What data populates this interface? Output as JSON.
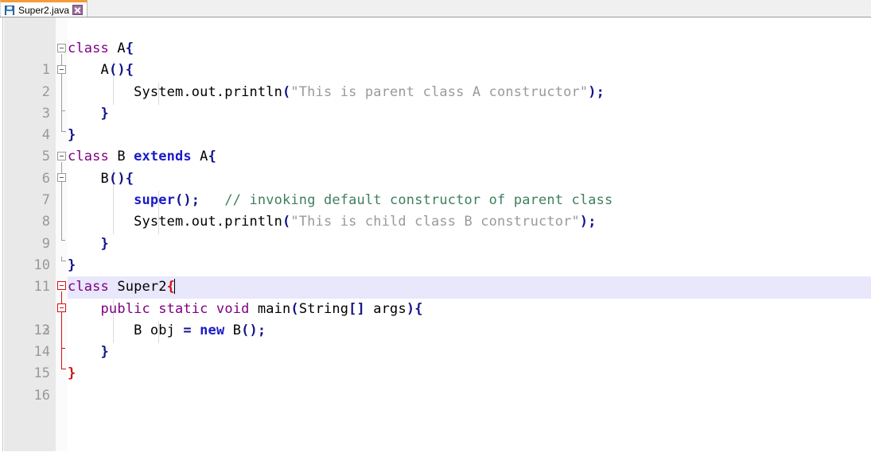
{
  "window": {
    "title": "Super2.java"
  },
  "tab": {
    "label": "Super2.java",
    "save_icon": "save-floppy-icon",
    "close_icon": "close-icon",
    "active": true,
    "active_indicator_color": "#f29d38"
  },
  "editor": {
    "language": "java",
    "current_line": 12,
    "caret_line": 12,
    "caret_column": 15,
    "colors": {
      "background": "#ffffff",
      "gutter": "#e9e9e9",
      "line_number": "#999999",
      "current_line_highlight": "#e9e7fb",
      "keyword": "#7f0080",
      "keyword_bold": "#1a1acc",
      "punctuation": "#14148c",
      "string": "#9a9a9a",
      "comment": "#3f7f5f",
      "matched_brace": "#d01414",
      "identifier": "#000000"
    },
    "line_numbers": [
      1,
      2,
      3,
      4,
      5,
      6,
      7,
      8,
      9,
      10,
      11,
      12,
      13,
      14,
      15,
      16
    ],
    "lines": [
      {
        "n": 1,
        "text": "class A{"
      },
      {
        "n": 2,
        "text": "    A(){"
      },
      {
        "n": 3,
        "text": "        System.out.println(\"This is parent class A constructor\");"
      },
      {
        "n": 4,
        "text": "    }"
      },
      {
        "n": 5,
        "text": "}"
      },
      {
        "n": 6,
        "text": "class B extends A{"
      },
      {
        "n": 7,
        "text": "    B(){"
      },
      {
        "n": 8,
        "text": "        super();   // invoking default constructor of parent class"
      },
      {
        "n": 9,
        "text": "        System.out.println(\"This is child class B constructor\");"
      },
      {
        "n": 10,
        "text": "    }"
      },
      {
        "n": 11,
        "text": "}"
      },
      {
        "n": 12,
        "text": "class Super2{"
      },
      {
        "n": 13,
        "text": "    public static void main(String[] args){"
      },
      {
        "n": 14,
        "text": "        B obj = new B();"
      },
      {
        "n": 15,
        "text": "    }"
      },
      {
        "n": 16,
        "text": "}"
      }
    ],
    "fold_markers": [
      {
        "line": 1,
        "state": "expanded",
        "color": "gray"
      },
      {
        "line": 2,
        "state": "expanded",
        "color": "gray"
      },
      {
        "line": 6,
        "state": "expanded",
        "color": "gray"
      },
      {
        "line": 7,
        "state": "expanded",
        "color": "gray"
      },
      {
        "line": 12,
        "state": "expanded",
        "color": "red"
      },
      {
        "line": 13,
        "state": "expanded",
        "color": "red"
      }
    ]
  }
}
